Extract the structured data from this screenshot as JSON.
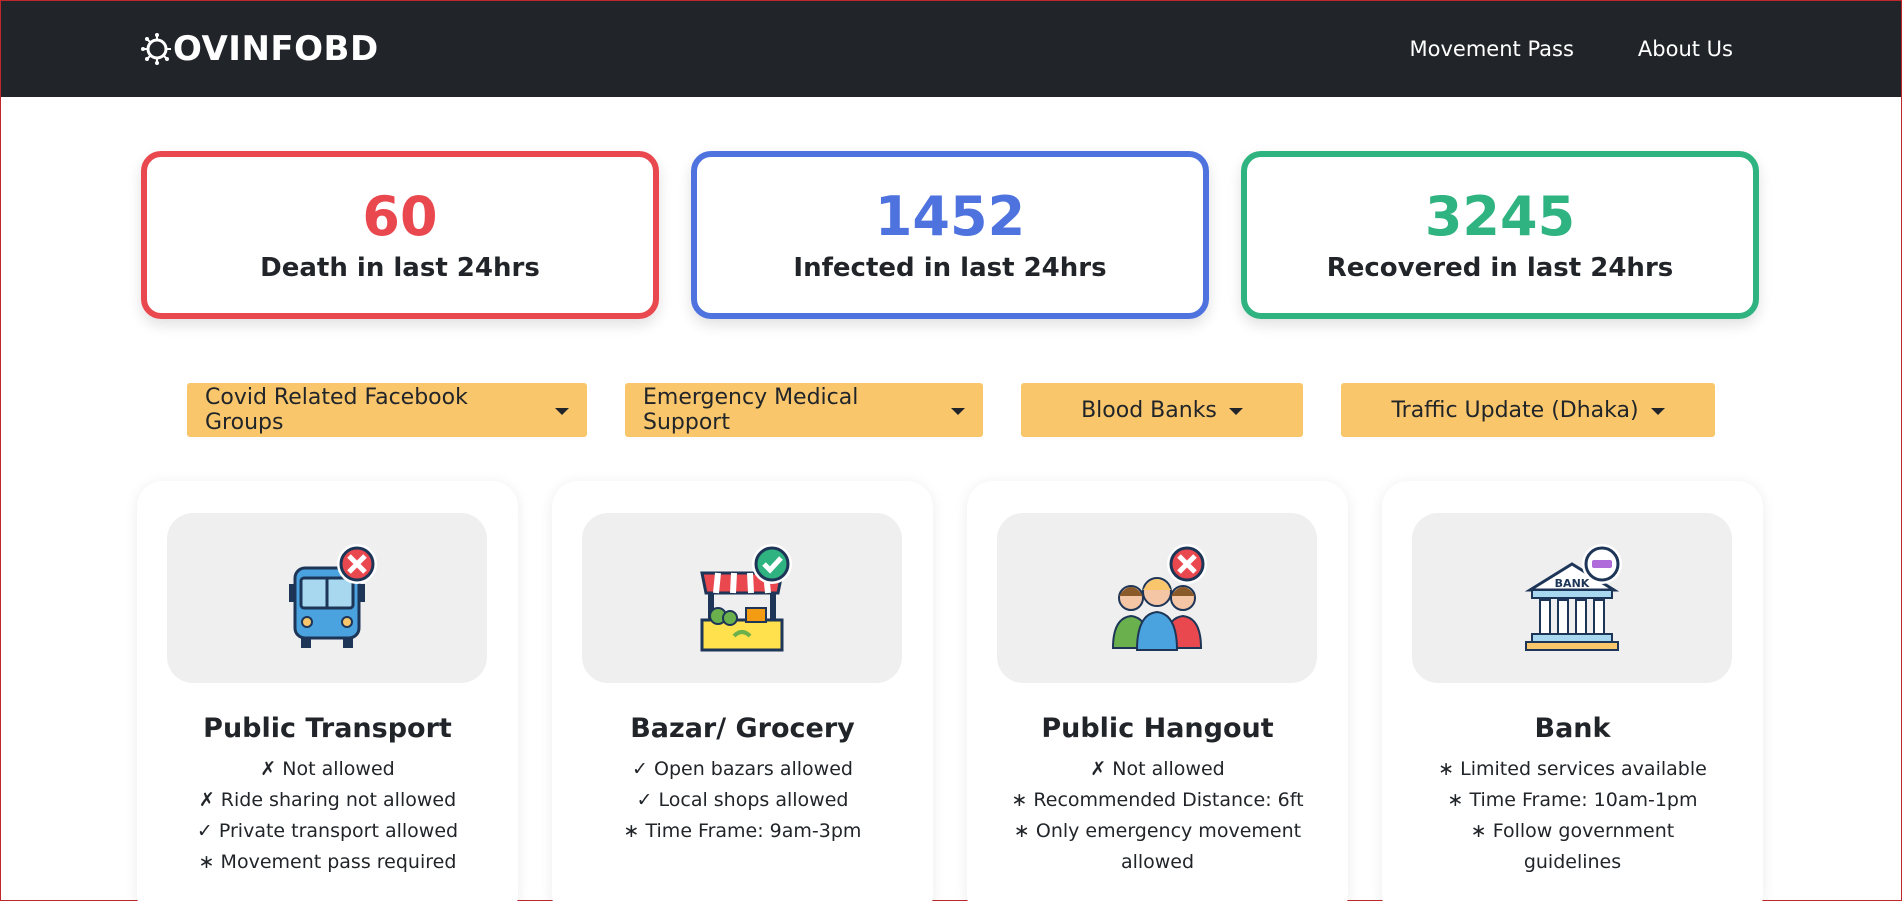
{
  "nav": {
    "brand": "COVINFOBD",
    "links": [
      "Movement Pass",
      "About Us"
    ]
  },
  "stats": [
    {
      "value": "60",
      "label": "Death in last 24hrs",
      "color": "#e9484f"
    },
    {
      "value": "1452",
      "label": "Infected in last 24hrs",
      "color": "#4e73df"
    },
    {
      "value": "3245",
      "label": "Recovered in last 24hrs",
      "color": "#2fb380"
    }
  ],
  "dropdowns": [
    "Covid Related Facebook Groups",
    "Emergency Medical Support",
    "Blood Banks",
    "Traffic Update (Dhaka)"
  ],
  "cards": [
    {
      "title": "Public Transport",
      "icon": "bus-icon",
      "status": "not-allowed",
      "lines": [
        "✗ Not allowed",
        "✗ Ride sharing not allowed",
        "✓ Private transport allowed",
        "∗ Movement pass required"
      ]
    },
    {
      "title": "Bazar/ Grocery",
      "icon": "market-stall-icon",
      "status": "allowed",
      "lines": [
        "✓ Open bazars allowed",
        "✓ Local shops allowed",
        "∗ Time Frame: 9am-3pm"
      ]
    },
    {
      "title": "Public Hangout",
      "icon": "people-group-icon",
      "status": "not-allowed",
      "lines": [
        "✗ Not allowed",
        "∗ Recommended Distance: 6ft",
        "∗ Only emergency movement",
        "allowed"
      ]
    },
    {
      "title": "Bank",
      "icon": "bank-icon",
      "status": "limited",
      "lines": [
        "∗ Limited services available",
        "∗ Time Frame: 10am-1pm",
        "∗ Follow government",
        "guidelines"
      ]
    }
  ],
  "colors": {
    "navbar": "#212529",
    "dropdown": "#f9c66b",
    "card_image_bg": "#efefef"
  }
}
